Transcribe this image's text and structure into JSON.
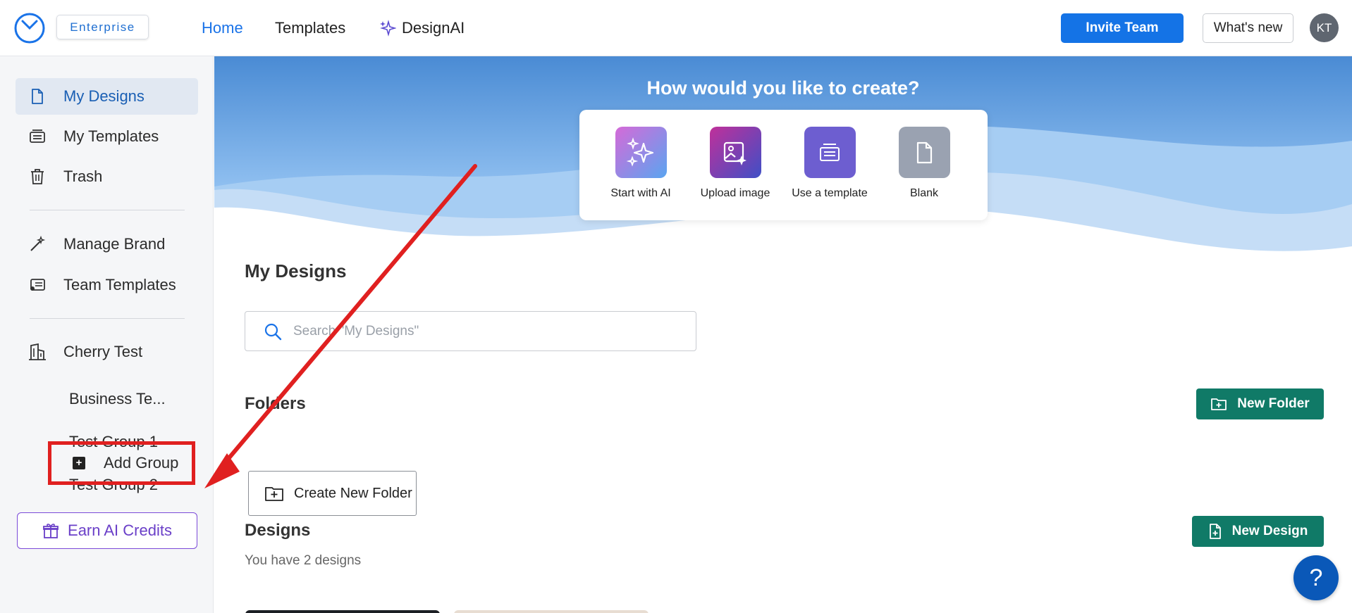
{
  "header": {
    "badge": "Enterprise",
    "nav": [
      "Home",
      "Templates",
      "DesignAI"
    ],
    "invite_label": "Invite Team",
    "whats_new_label": "What's new",
    "avatar_initials": "KT"
  },
  "sidebar": {
    "items": [
      "My Designs",
      "My Templates",
      "Trash",
      "Manage Brand",
      "Team Templates",
      "Cherry Test"
    ],
    "groups": [
      "Business Te...",
      "Test Group 1",
      "Test Group 2"
    ],
    "add_group_label": "Add Group",
    "earn_label": "Earn AI Credits"
  },
  "hero": {
    "title": "How would you like to create?",
    "options": [
      {
        "label": "Start with AI",
        "color": "#b56be8"
      },
      {
        "label": "Upload image",
        "color": "#b0359e"
      },
      {
        "label": "Use a template",
        "color": "#6d5ed0"
      },
      {
        "label": "Blank",
        "color": "#9aa2b1"
      }
    ]
  },
  "main": {
    "title": "My Designs",
    "search_placeholder": "Search \"My Designs\"",
    "folders_title": "Folders",
    "new_folder_label": "New Folder",
    "create_folder_label": "Create New Folder",
    "designs_title": "Designs",
    "new_design_label": "New Design",
    "designs_count_text": "You have 2 designs"
  },
  "help_label": "?",
  "colors": {
    "primary": "#1473e6",
    "green": "#107a67",
    "highlight_red": "#e02020",
    "purple": "#7b4ad8"
  }
}
